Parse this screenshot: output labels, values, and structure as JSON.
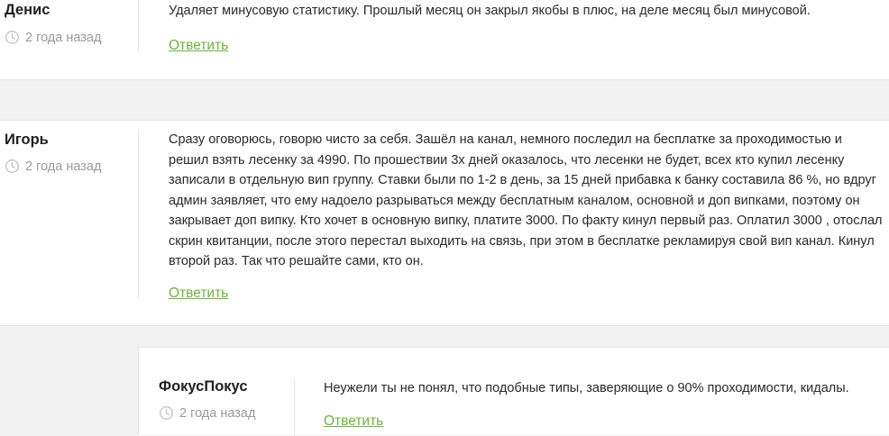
{
  "comments": [
    {
      "author": "Денис",
      "time": "2 года назад",
      "text": "Удаляет минусовую статистику. Прошлый месяц он закрыл якобы в плюс, на деле месяц был минусовой.",
      "reply_label": "Ответить"
    },
    {
      "author": "Игорь",
      "time": "2 года назад",
      "text": "Сразу оговорюсь, говорю чисто за себя. Зашёл на канал, немного последил на бесплатке за проходимостью и решил взять лесенку за 4990. По прошествии 3х дней оказалось, что лесенки не будет, всех кто купил лесенку записали в отдельную вип группу. Ставки были по 1-2 в день, за 15 дней прибавка к банку составила 86 %, но вдруг админ заявляет, что ему надоело разрываться между бесплатным каналом, основной и доп випками, поэтому он закрывает доп випку. Кто хочет в основную випку, платите 3000. По факту кинул первый раз. Оплатил 3000 , отослал скрин квитанции, после этого перестал выходить на связь, при этом в бесплатке рекламируя свой вип канал. Кинул второй раз. Так что решайте сами, кто он.",
      "reply_label": "Ответить"
    }
  ],
  "reply": {
    "author": "ФокусПокус",
    "time": "2 года назад",
    "text": "Неужели ты не понял, что подобные типы, заверяющие о 90% проходимости, кидалы.",
    "reply_label": "Ответить"
  },
  "icons": {
    "time": "clock-icon"
  },
  "colors": {
    "link": "#6db33f",
    "muted": "#9a9a9a",
    "background": "#f2f2f2"
  }
}
